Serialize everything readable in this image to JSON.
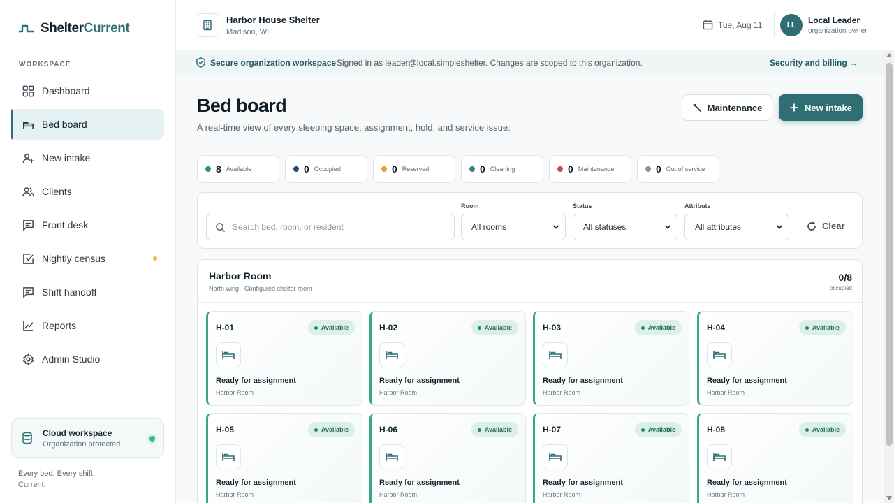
{
  "app": {
    "brand_a": "Shelter",
    "brand_b": "Current",
    "workspace_label": "WORKSPACE",
    "tagline": "Every bed. Every shift. Current."
  },
  "sidebar": {
    "items": [
      {
        "label": "Dashboard",
        "icon": "grid-icon"
      },
      {
        "label": "Bed board",
        "icon": "bed-icon",
        "active": true
      },
      {
        "label": "New intake",
        "icon": "user-plus-icon"
      },
      {
        "label": "Clients",
        "icon": "users-icon"
      },
      {
        "label": "Front desk",
        "icon": "message-square-icon"
      },
      {
        "label": "Nightly census",
        "icon": "check-square-icon",
        "dot": true
      },
      {
        "label": "Shift handoff",
        "icon": "message-square-icon"
      },
      {
        "label": "Reports",
        "icon": "line-chart-icon"
      },
      {
        "label": "Admin Studio",
        "icon": "gear-icon"
      }
    ],
    "cloud": {
      "title": "Cloud workspace",
      "subtitle": "Organization protected"
    }
  },
  "topbar": {
    "org_name": "Harbor House Shelter",
    "org_location": "Madison, WI",
    "date": "Tue, Aug 11",
    "avatar_initials": "LL",
    "user_name": "Local Leader",
    "user_role": "organization owner"
  },
  "banner": {
    "title": "Secure organization workspace",
    "text": "Signed in as leader@local.simpleshelter. Changes are scoped to this organization.",
    "link": "Security and billing →"
  },
  "page": {
    "title": "Bed board",
    "subtitle": "A real-time view of every sleeping space, assignment, hold, and service issue.",
    "maintenance_label": "Maintenance",
    "new_intake_label": "New intake"
  },
  "stats": [
    {
      "count": "8",
      "label": "Available",
      "color": "#2f8f7c"
    },
    {
      "count": "0",
      "label": "Occupied",
      "color": "#2f4a66"
    },
    {
      "count": "0",
      "label": "Reserved",
      "color": "#e0a23c"
    },
    {
      "count": "0",
      "label": "Cleaning",
      "color": "#3a7f86"
    },
    {
      "count": "0",
      "label": "Maintenance",
      "color": "#c44c4c"
    },
    {
      "count": "0",
      "label": "Out of service",
      "color": "#8a95a0"
    }
  ],
  "filters": {
    "search_placeholder": "Search bed, room, or resident",
    "room_label": "Room",
    "room_value": "All rooms",
    "status_label": "Status",
    "status_value": "All statuses",
    "attribute_label": "Attribute",
    "attribute_value": "All attributes",
    "clear_label": "Clear"
  },
  "room": {
    "name": "Harbor Room",
    "description": "North wing · Configured shelter room",
    "occupancy": "0/8",
    "occupancy_label": "occupied",
    "beds": [
      {
        "id": "H-01",
        "badge": "Available",
        "status": "Ready for assignment",
        "room": "Harbor Room"
      },
      {
        "id": "H-02",
        "badge": "Available",
        "status": "Ready for assignment",
        "room": "Harbor Room"
      },
      {
        "id": "H-03",
        "badge": "Available",
        "status": "Ready for assignment",
        "room": "Harbor Room"
      },
      {
        "id": "H-04",
        "badge": "Available",
        "status": "Ready for assignment",
        "room": "Harbor Room"
      },
      {
        "id": "H-05",
        "badge": "Available",
        "status": "Ready for assignment",
        "room": "Harbor Room"
      },
      {
        "id": "H-06",
        "badge": "Available",
        "status": "Ready for assignment",
        "room": "Harbor Room"
      },
      {
        "id": "H-07",
        "badge": "Available",
        "status": "Ready for assignment",
        "room": "Harbor Room"
      },
      {
        "id": "H-08",
        "badge": "Available",
        "status": "Ready for assignment",
        "room": "Harbor Room"
      }
    ]
  },
  "colors": {
    "accent": "#2f6f74",
    "available": "#3ba58a",
    "alert_dot": "#f2b441",
    "online": "#2fbf7e"
  }
}
